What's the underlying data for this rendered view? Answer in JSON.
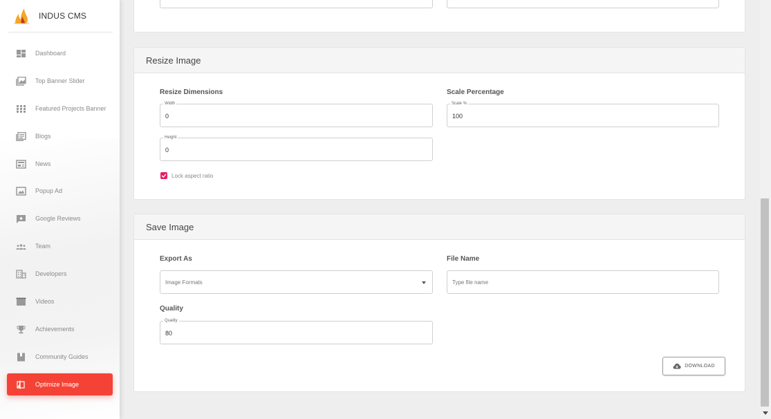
{
  "brand": {
    "name": "INDUS CMS"
  },
  "sidebar": {
    "items": [
      {
        "label": "Dashboard",
        "icon": "dashboard-icon"
      },
      {
        "label": "Top Banner Slider",
        "icon": "image-slider-icon"
      },
      {
        "label": "Featured Projects Banner",
        "icon": "grid-icon"
      },
      {
        "label": "Blogs",
        "icon": "article-icon"
      },
      {
        "label": "News",
        "icon": "news-icon"
      },
      {
        "label": "Popup Ad",
        "icon": "popup-icon"
      },
      {
        "label": "Google Reviews",
        "icon": "review-icon"
      },
      {
        "label": "Team",
        "icon": "team-icon"
      },
      {
        "label": "Developers",
        "icon": "building-icon"
      },
      {
        "label": "Videos",
        "icon": "video-icon"
      },
      {
        "label": "Achievements",
        "icon": "trophy-icon"
      },
      {
        "label": "Community Guides",
        "icon": "book-icon"
      },
      {
        "label": "Optimize Image",
        "icon": "compare-icon",
        "active": true
      }
    ],
    "active_color": "#f44336"
  },
  "resize": {
    "title": "Resize Image",
    "dimensions_title": "Resize Dimensions",
    "width_legend": "Width",
    "width_value": "0",
    "height_legend": "Height",
    "height_value": "0",
    "lock_label": "Lock aspect ratio",
    "lock_checked": true,
    "scale_title": "Scale Percentage",
    "scale_legend": "Scale %",
    "scale_value": "100"
  },
  "save": {
    "title": "Save Image",
    "export_title": "Export As",
    "export_placeholder": "Image Formats",
    "filename_title": "File Name",
    "filename_placeholder": "Type file name",
    "quality_title": "Quality",
    "quality_legend": "Quality",
    "quality_value": "80",
    "download_label": "DOWNLOAD"
  },
  "colors": {
    "checkbox": "#e91e63",
    "active_nav": "#f44336"
  }
}
